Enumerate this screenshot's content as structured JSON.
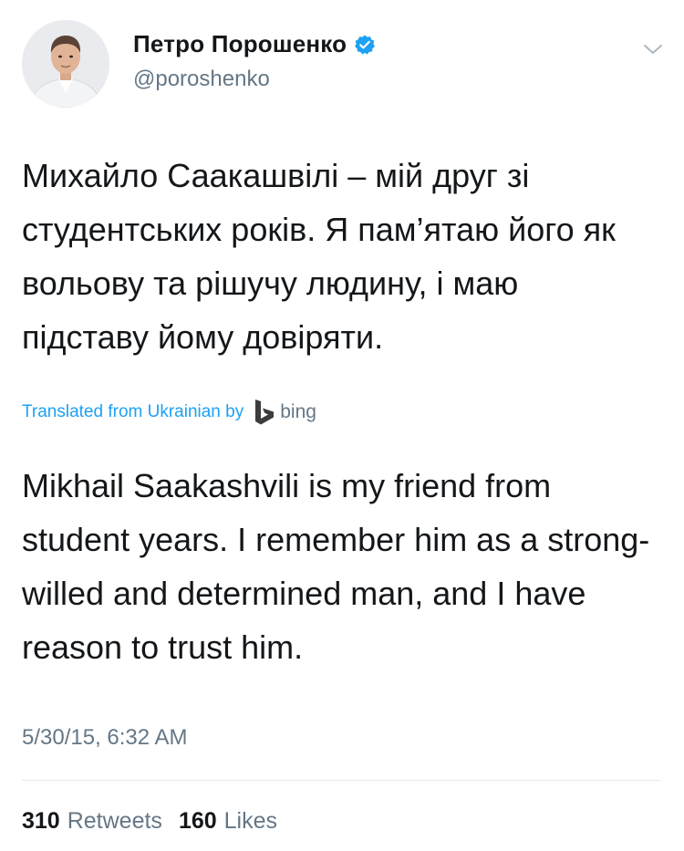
{
  "author": {
    "display_name": "Петро Порошенко",
    "handle": "@poroshenko",
    "verified_icon": "verified-badge-icon",
    "avatar": "profile-photo"
  },
  "menu": {
    "icon": "chevron-down-icon"
  },
  "tweet": {
    "text": "Михайло Саакашвілі – мій друг зі студентських років. Я пам’ятаю його як вольову та рішучу людину, і маю підставу йому довіряти."
  },
  "translation": {
    "label": "Translated from Ukrainian by",
    "provider": "bing",
    "provider_icon": "bing-logo-icon",
    "text": "Mikhail Saakashvili is my friend from student years. I remember him as a strong-willed and determined man, and I have reason to trust him."
  },
  "timestamp": "5/30/15, 6:32 AM",
  "stats": {
    "retweets_count": "310",
    "retweets_label": "Retweets",
    "likes_count": "160",
    "likes_label": "Likes"
  },
  "colors": {
    "link": "#1da1f2",
    "secondary_text": "#657786",
    "primary_text": "#14171a",
    "divider": "#e1e8ed"
  }
}
